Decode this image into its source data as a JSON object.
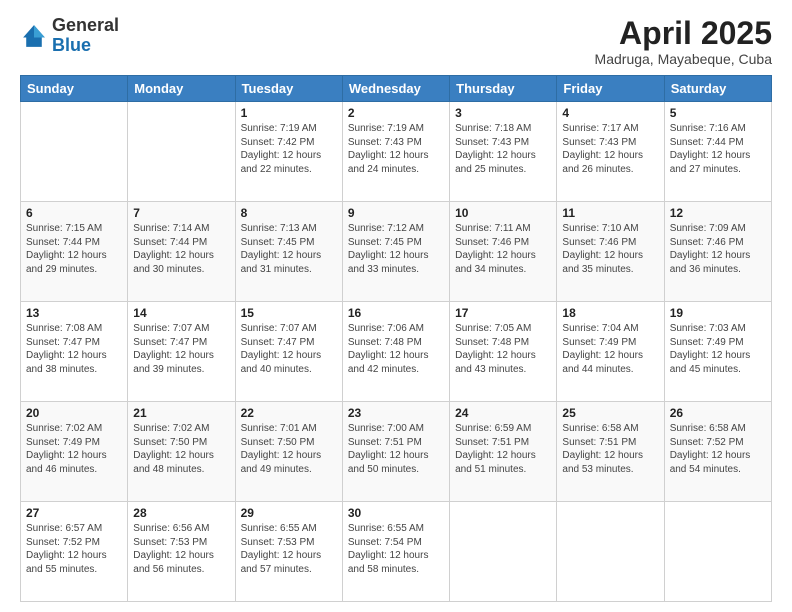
{
  "header": {
    "logo_general": "General",
    "logo_blue": "Blue",
    "month_title": "April 2025",
    "location": "Madruga, Mayabeque, Cuba"
  },
  "days_of_week": [
    "Sunday",
    "Monday",
    "Tuesday",
    "Wednesday",
    "Thursday",
    "Friday",
    "Saturday"
  ],
  "weeks": [
    [
      {
        "day": "",
        "info": ""
      },
      {
        "day": "",
        "info": ""
      },
      {
        "day": "1",
        "sunrise": "7:19 AM",
        "sunset": "7:42 PM",
        "daylight": "12 hours and 22 minutes."
      },
      {
        "day": "2",
        "sunrise": "7:19 AM",
        "sunset": "7:43 PM",
        "daylight": "12 hours and 24 minutes."
      },
      {
        "day": "3",
        "sunrise": "7:18 AM",
        "sunset": "7:43 PM",
        "daylight": "12 hours and 25 minutes."
      },
      {
        "day": "4",
        "sunrise": "7:17 AM",
        "sunset": "7:43 PM",
        "daylight": "12 hours and 26 minutes."
      },
      {
        "day": "5",
        "sunrise": "7:16 AM",
        "sunset": "7:44 PM",
        "daylight": "12 hours and 27 minutes."
      }
    ],
    [
      {
        "day": "6",
        "sunrise": "7:15 AM",
        "sunset": "7:44 PM",
        "daylight": "12 hours and 29 minutes."
      },
      {
        "day": "7",
        "sunrise": "7:14 AM",
        "sunset": "7:44 PM",
        "daylight": "12 hours and 30 minutes."
      },
      {
        "day": "8",
        "sunrise": "7:13 AM",
        "sunset": "7:45 PM",
        "daylight": "12 hours and 31 minutes."
      },
      {
        "day": "9",
        "sunrise": "7:12 AM",
        "sunset": "7:45 PM",
        "daylight": "12 hours and 33 minutes."
      },
      {
        "day": "10",
        "sunrise": "7:11 AM",
        "sunset": "7:46 PM",
        "daylight": "12 hours and 34 minutes."
      },
      {
        "day": "11",
        "sunrise": "7:10 AM",
        "sunset": "7:46 PM",
        "daylight": "12 hours and 35 minutes."
      },
      {
        "day": "12",
        "sunrise": "7:09 AM",
        "sunset": "7:46 PM",
        "daylight": "12 hours and 36 minutes."
      }
    ],
    [
      {
        "day": "13",
        "sunrise": "7:08 AM",
        "sunset": "7:47 PM",
        "daylight": "12 hours and 38 minutes."
      },
      {
        "day": "14",
        "sunrise": "7:07 AM",
        "sunset": "7:47 PM",
        "daylight": "12 hours and 39 minutes."
      },
      {
        "day": "15",
        "sunrise": "7:07 AM",
        "sunset": "7:47 PM",
        "daylight": "12 hours and 40 minutes."
      },
      {
        "day": "16",
        "sunrise": "7:06 AM",
        "sunset": "7:48 PM",
        "daylight": "12 hours and 42 minutes."
      },
      {
        "day": "17",
        "sunrise": "7:05 AM",
        "sunset": "7:48 PM",
        "daylight": "12 hours and 43 minutes."
      },
      {
        "day": "18",
        "sunrise": "7:04 AM",
        "sunset": "7:49 PM",
        "daylight": "12 hours and 44 minutes."
      },
      {
        "day": "19",
        "sunrise": "7:03 AM",
        "sunset": "7:49 PM",
        "daylight": "12 hours and 45 minutes."
      }
    ],
    [
      {
        "day": "20",
        "sunrise": "7:02 AM",
        "sunset": "7:49 PM",
        "daylight": "12 hours and 46 minutes."
      },
      {
        "day": "21",
        "sunrise": "7:02 AM",
        "sunset": "7:50 PM",
        "daylight": "12 hours and 48 minutes."
      },
      {
        "day": "22",
        "sunrise": "7:01 AM",
        "sunset": "7:50 PM",
        "daylight": "12 hours and 49 minutes."
      },
      {
        "day": "23",
        "sunrise": "7:00 AM",
        "sunset": "7:51 PM",
        "daylight": "12 hours and 50 minutes."
      },
      {
        "day": "24",
        "sunrise": "6:59 AM",
        "sunset": "7:51 PM",
        "daylight": "12 hours and 51 minutes."
      },
      {
        "day": "25",
        "sunrise": "6:58 AM",
        "sunset": "7:51 PM",
        "daylight": "12 hours and 53 minutes."
      },
      {
        "day": "26",
        "sunrise": "6:58 AM",
        "sunset": "7:52 PM",
        "daylight": "12 hours and 54 minutes."
      }
    ],
    [
      {
        "day": "27",
        "sunrise": "6:57 AM",
        "sunset": "7:52 PM",
        "daylight": "12 hours and 55 minutes."
      },
      {
        "day": "28",
        "sunrise": "6:56 AM",
        "sunset": "7:53 PM",
        "daylight": "12 hours and 56 minutes."
      },
      {
        "day": "29",
        "sunrise": "6:55 AM",
        "sunset": "7:53 PM",
        "daylight": "12 hours and 57 minutes."
      },
      {
        "day": "30",
        "sunrise": "6:55 AM",
        "sunset": "7:54 PM",
        "daylight": "12 hours and 58 minutes."
      },
      {
        "day": "",
        "info": ""
      },
      {
        "day": "",
        "info": ""
      },
      {
        "day": "",
        "info": ""
      }
    ]
  ],
  "labels": {
    "sunrise_prefix": "Sunrise: ",
    "sunset_prefix": "Sunset: ",
    "daylight_prefix": "Daylight: "
  }
}
